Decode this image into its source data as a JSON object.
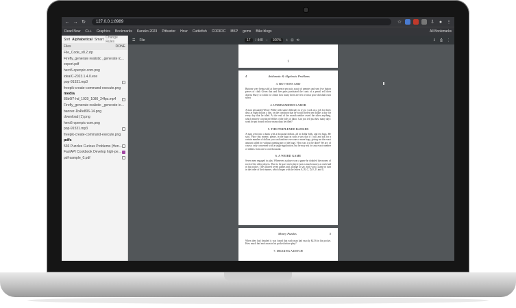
{
  "browser": {
    "url": "127.0.0.1:8989",
    "bookmarks": [
      "Read Now",
      "C++",
      "Graphics",
      "Bookmarks",
      "Kaneko 2023",
      "Pitbuster",
      "Hour",
      "Cuttlefish",
      "CODIFIC",
      "MKP",
      "gems",
      "Bike blogs"
    ],
    "all_bookmarks": "All Bookmarks"
  },
  "sidebar": {
    "sort_label": "Sort",
    "sort_mode": "Alphabetical",
    "sort_alt": "Smart",
    "change_rules": "Change Rules",
    "col_files": "Files",
    "col_done": "DONE",
    "root_items": [
      {
        "name": "File_Code_v8.2.zip",
        "cb": false
      },
      {
        "name": "Firefly_generate realistic _generate ico...",
        "cb": false
      },
      {
        "name": "export.pdf",
        "cb": false
      },
      {
        "name": "hero5-openpic-com.png",
        "cb": false
      },
      {
        "name": "ideaIC-2023.1.4.0.exe",
        "cb": false
      },
      {
        "name": "pop-91531.mp3",
        "cb": true
      },
      {
        "name": "freepik-create-command-execute.png",
        "cb": false
      }
    ],
    "media_title": "media",
    "media_items": [
      {
        "name": "85b6f7-hd_1920_1080_24fps.mp4",
        "cb": true
      },
      {
        "name": "Firefly_generate realistic _generate ico...",
        "cb": false
      },
      {
        "name": "banner-1b4fe806-14.png",
        "cb": false
      },
      {
        "name": "download (1).png",
        "cb": false
      },
      {
        "name": "hero5-openpic-com.png",
        "cb": false
      },
      {
        "name": "pop-91531.mp3",
        "cb": true
      },
      {
        "name": "freepik-create-command-execute.png",
        "cb": false
      }
    ],
    "pdfs_title": "pdfs",
    "pdf_items": [
      {
        "name": "536 Puzzles Curious Problems (Hen...",
        "cb": true
      },
      {
        "name": "FastAPI Cookbook Develop high-per...",
        "cb": true,
        "on": true
      },
      {
        "name": "pdf-sample_0.pdf",
        "cb": true
      }
    ]
  },
  "pdf": {
    "filename": "File",
    "page_current": "17",
    "page_total": "/ 440",
    "zoom": "100%",
    "page1_number": "1",
    "page2_running": "Arithmetic & Algebraic Problems",
    "page2_number": "4",
    "sections": [
      {
        "title": "3. BUTTONS AND",
        "text": "Buttons were being sold at three pence per pair, a pair of pennies and sent five button pieces of cloth Given that and five pairs purchased the coats of a pencil sell their dozens Hurry to which for Annie how many there are left of what price did shall each select"
      },
      {
        "title": "4. UNREWARDED LABOR",
        "text": "A man persuaded Weary Willie with some difficulty to try to work on a job for thirty days at eight dollars a day, on the condition that he would forfeit ten dollars a day for every day that he idled. At the end of the month neither owed the other anything, which entirely convinced Willie of the folly of labor. Can you tell just how many days' work he put in and on how many days he idled?"
      },
      {
        "title": "5. THE PERPLEXED BANKER",
        "text": "A man went into a bank with a thousand dollars, all in dollar bills, and ten bags. He said, 'Place this money, please, in the bags in such a way that if I call and ask for a certain number of dollars you can hand me over one or more bags, giving me the exact amount called for without opening any of the bags.' How was it to be done? We are, of course, only concerned with a single application, but he may ask for any exact number of dollars from one to one thousand."
      },
      {
        "title": "6. A WEIRD GAME",
        "text": "Seven men engaged in play. Whenever a player won a game he doubled the money of each of the other players. That is, he gave each player just as much money as each had in his pocket. They played seven games and, strange to say, each won a game in turn in the order of their names, which began with the letters A, B, C, D, E, F, and G."
      },
      {
        "title": "",
        "text": ""
      }
    ],
    "page3_running": "Money Puzzles",
    "page3_number": "5",
    "page3_text": "When they had finished it was found that each man had exactly $2.56 in his pocket. How much had each man in his pocket before play?",
    "page3_section": "7. DIGGING A DITCH"
  }
}
